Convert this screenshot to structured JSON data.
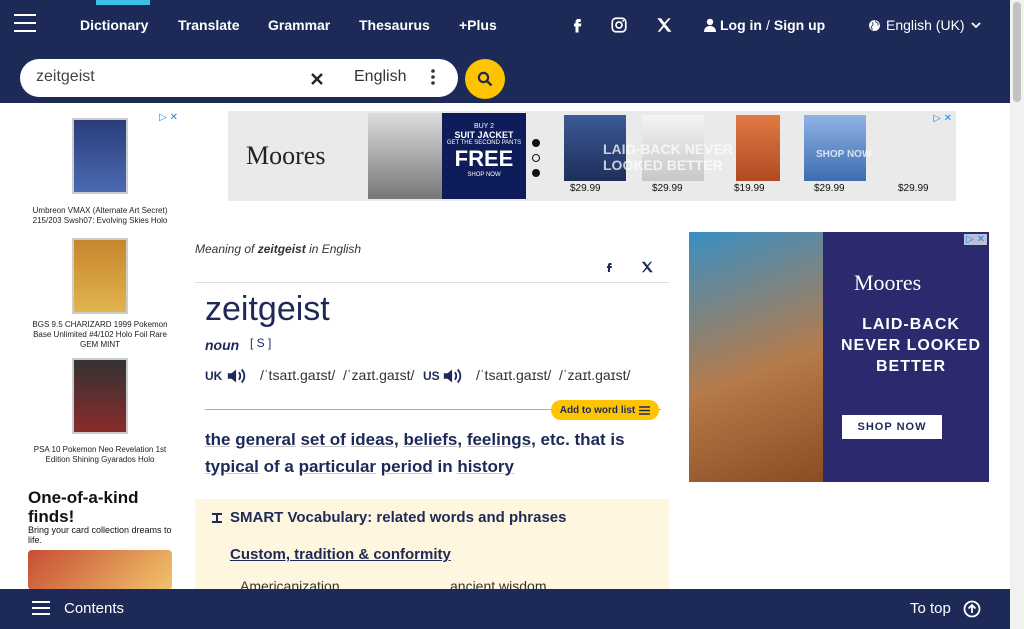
{
  "header": {
    "nav": [
      {
        "label": "Dictionary"
      },
      {
        "label": "Translate"
      },
      {
        "label": "Grammar"
      },
      {
        "label": "Thesaurus"
      },
      {
        "label": "+Plus"
      }
    ],
    "login": "Log in",
    "separator": "/",
    "signup": "Sign up",
    "language": "English (UK)"
  },
  "search": {
    "value": "zeitgeist",
    "dictionary": "English"
  },
  "left_ad": {
    "captions": [
      "Umbreon VMAX (Alternate Art Secret) 215/203 Swsh07: Evolving Skies Holo",
      "BGS 9.5 CHARIZARD 1999 Pokemon Base Unlimited #4/102 Holo Foil Rare GEM MINT",
      "PSA 10 Pokemon Neo Revelation 1st Edition Shining Gyarados Holo"
    ],
    "promo": "One-of-a-kind finds!",
    "sub": "Bring your card collection dreams to life."
  },
  "banner_ad": {
    "brand": "Moores",
    "promo_top": "BUY 2",
    "promo_mid": "SUIT JACKET",
    "promo_line": "GET THE SECOND PANTS",
    "promo_free": "FREE",
    "promo_shop": "SHOP NOW",
    "overlay": "LAID-BACK NEVER LOOKED BETTER",
    "shop": "SHOP NOW",
    "prices": [
      "$29.99",
      "$29.99",
      "$19.99",
      "$29.99",
      "$29.99"
    ]
  },
  "entry": {
    "meaning_prefix": "Meaning of",
    "meaning_word": "zeitgeist",
    "meaning_suffix": "in English",
    "headword": "zeitgeist",
    "pos": "noun",
    "pos_info": "[ S ]",
    "uk_label": "UK",
    "us_label": "US",
    "uk_ipa_1": "/ˈtsaɪt.ɡaɪst/",
    "uk_ipa_2": "/ˈzaɪt.ɡaɪst/",
    "us_ipa_1": "/ˈtsaɪt.ɡaɪst/",
    "us_ipa_2": "/ˈzaɪt.ɡaɪst/",
    "add_to_list": "Add to word list",
    "definition": {
      "w_the": "the",
      "w_general": "general",
      "w_set_of": "set of",
      "w_ideas": "ideas",
      "w_comma": ",",
      "w_beliefs": "beliefs",
      "w_feelings": "feelings",
      "w_etc": ", etc. that is",
      "w_typical": "typical",
      "w_of_a": "of a",
      "w_particular": "particular",
      "w_period": "period",
      "w_in": "in",
      "w_history": "history"
    }
  },
  "smart_vocab": {
    "title": "SMART Vocabulary: related words and phrases",
    "link": "Custom, tradition & conformity",
    "words": [
      "Americanization",
      "ancient wisdom"
    ]
  },
  "right_ad": {
    "brand": "Moores",
    "headline": "LAID-BACK NEVER LOOKED BETTER",
    "button": "SHOP NOW"
  },
  "footer": {
    "contents": "Contents",
    "to_top": "To top"
  }
}
